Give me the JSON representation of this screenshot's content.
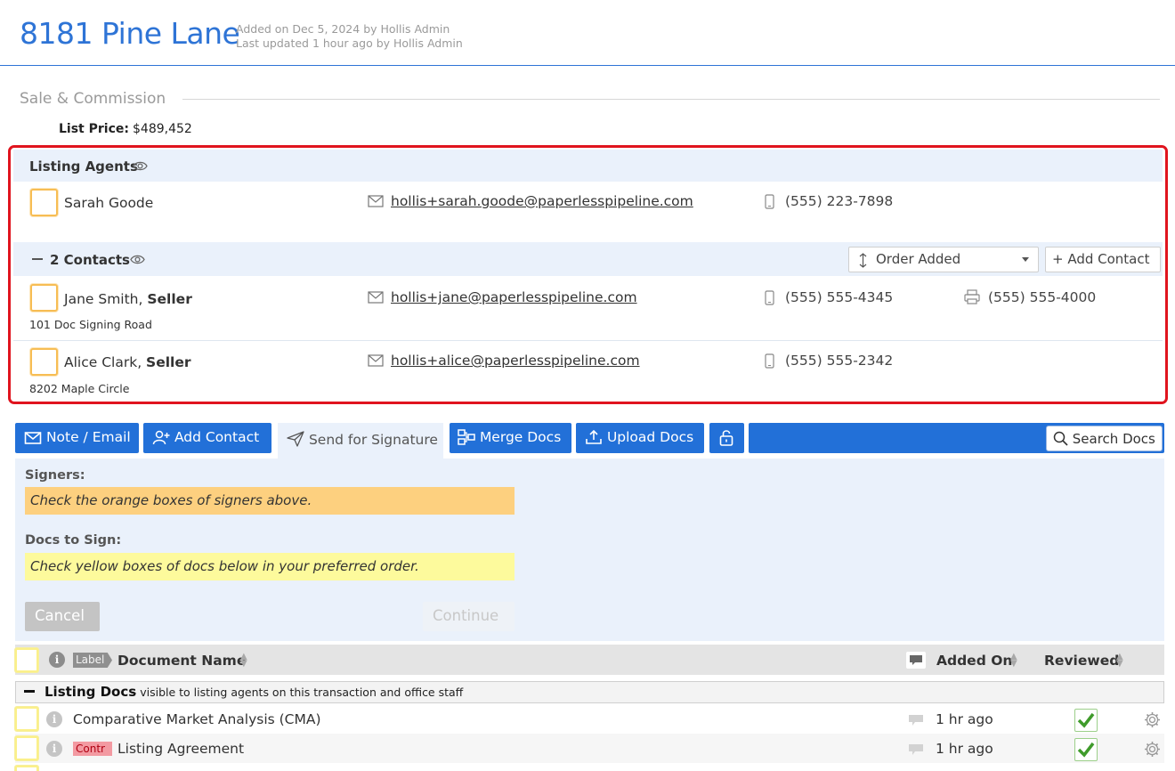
{
  "header": {
    "title": "8181 Pine Lane",
    "added": "Added on Dec 5, 2024 by Hollis Admin",
    "updated": "Last updated 1 hour ago by Hollis Admin"
  },
  "section": {
    "heading": "Sale & Commission"
  },
  "list_price": {
    "label": "List Price:",
    "value": "$489,452"
  },
  "listing_agents": {
    "title": "Listing Agents",
    "agents": [
      {
        "name": "Sarah Goode",
        "email": "hollis+sarah.goode@paperlesspipeline.com",
        "phone": "(555) 223-7898"
      }
    ]
  },
  "contacts": {
    "title": "2 Contacts",
    "order_label": "Order Added",
    "add_label": "+ Add Contact",
    "items": [
      {
        "name": "Jane Smith",
        "role": "Seller",
        "address": "101 Doc Signing Road",
        "email": "hollis+jane@paperlesspipeline.com",
        "phone": "(555) 555-4345",
        "fax": "(555) 555-4000"
      },
      {
        "name": "Alice Clark",
        "role": "Seller",
        "address": "8202 Maple Circle",
        "email": "hollis+alice@paperlesspipeline.com",
        "phone": "(555) 555-2342"
      }
    ]
  },
  "toolbar": {
    "note_email": "Note / Email",
    "add_contact": "Add Contact",
    "send_signature": "Send for Signature",
    "merge_docs": "Merge Docs",
    "upload_docs": "Upload Docs",
    "search_docs": "Search Docs"
  },
  "signature_panel": {
    "signers_label": "Signers:",
    "signers_note": "Check the orange boxes of signers above.",
    "docs_label": "Docs to Sign:",
    "docs_note": "Check yellow boxes of docs below in your preferred order.",
    "cancel": "Cancel",
    "continue": "Continue"
  },
  "table": {
    "label_chip": "Label",
    "col_name": "Document Name",
    "col_added": "Added On",
    "col_reviewed": "Reviewed",
    "group": {
      "title": "Listing Docs",
      "description": "– visible to listing agents on this transaction and office staff"
    },
    "rows": [
      {
        "name": "Comparative Market Analysis (CMA)",
        "added": "1 hr ago",
        "reviewed": true
      },
      {
        "name": "Listing Agreement",
        "label": "Contr",
        "added": "1 hr ago",
        "reviewed": true
      }
    ]
  },
  "colors": {
    "brand_blue": "#2270d8",
    "alert_red": "#e0141e",
    "signer_orange": "#fdd07f",
    "doc_yellow": "#fdfa9c"
  }
}
